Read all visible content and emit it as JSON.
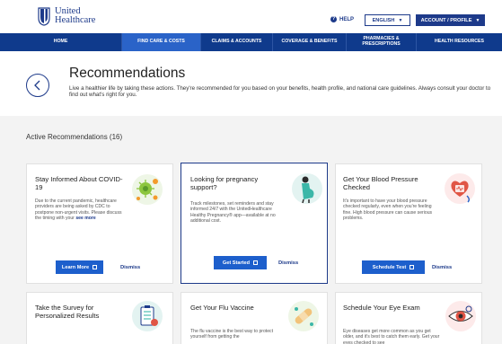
{
  "brand": {
    "line1": "United",
    "line2": "Healthcare"
  },
  "header": {
    "help_label": "HELP",
    "language_label": "ENGLISH",
    "account_label": "ACCOUNT / PROFILE"
  },
  "nav": {
    "items": [
      {
        "label": "HOME"
      },
      {
        "label": "FIND CARE & COSTS"
      },
      {
        "label": "CLAIMS & ACCOUNTS"
      },
      {
        "label": "COVERAGE & BENEFITS"
      },
      {
        "label": "PHARMACIES & PRESCRIPTIONS"
      },
      {
        "label": "HEALTH RESOURCES"
      }
    ],
    "active_index": 1
  },
  "page": {
    "title": "Recommendations",
    "description": "Live a healthier life by taking these actions. They're recommended for you based on your benefits, health profile, and national care guidelines. Always consult your doctor to find out what's right for you.",
    "section_title": "Active Recommendations (16)"
  },
  "cards": [
    {
      "title": "Stay Informed About COVID-19",
      "body": "Due to the current pandemic, healthcare providers are being asked by CDC to postpone non-urgent visits. Please discuss the timing with your",
      "see_more": "see more",
      "primary_label": "Learn More",
      "secondary_label": "Dismiss"
    },
    {
      "title": "Looking for pregnancy support?",
      "body": "Track milestones, set reminders and stay informed 24/7 with the UnitedHealthcare Healthy Pregnancy® app—available at no additional cost.",
      "primary_label": "Get Started",
      "secondary_label": "Dismiss"
    },
    {
      "title": "Get Your Blood Pressure Checked",
      "body": "It's important to have your blood pressure checked regularly, even when you're feeling fine. High blood pressure can cause serious problems.",
      "primary_label": "Schedule Test",
      "secondary_label": "Dismiss"
    },
    {
      "title": "Take the Survey for Personalized Results"
    },
    {
      "title": "Get Your Flu Vaccine",
      "body": "The flu vaccine is the best way to protect yourself from getting the"
    },
    {
      "title": "Schedule Your Eye Exam",
      "body": "Eye diseases get more common as you get older, and it's best to catch them early. Get your eyes checked to see"
    }
  ],
  "colors": {
    "brand_navy": "#1d3a8a",
    "nav_bg": "#0f3a8c",
    "nav_active": "#2a63c8",
    "button_blue": "#1d5fcc"
  }
}
